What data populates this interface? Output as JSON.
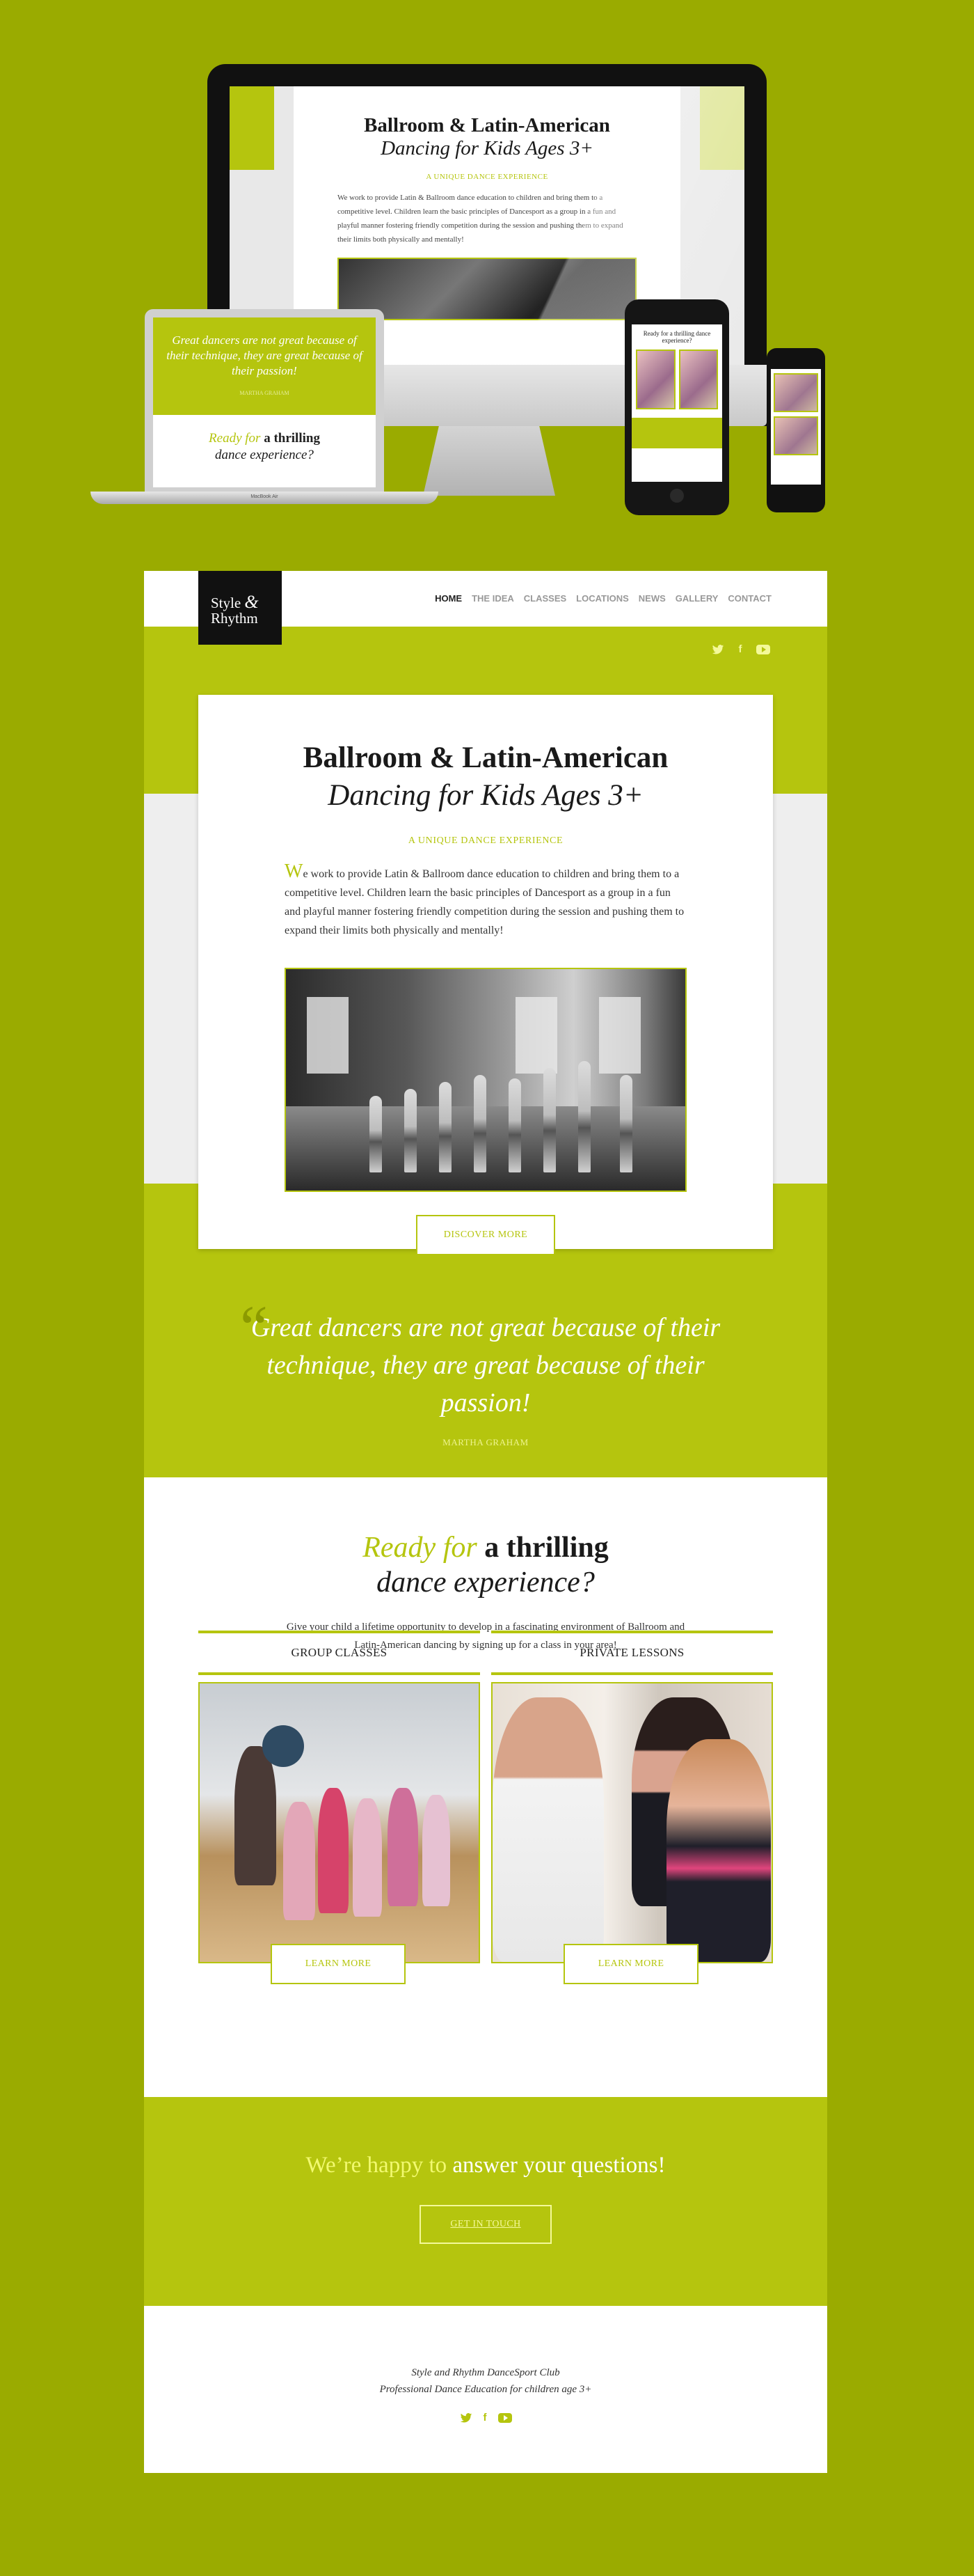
{
  "colors": {
    "page_bg": "#9aab00",
    "accent": "#b5c50e",
    "accent_light": "#f4f99a",
    "dark": "#111111"
  },
  "mockups": {
    "imac_title_1": "Ballroom & Latin-American",
    "imac_title_2": "Dancing for Kids Ages 3+",
    "imac_kicker": "A UNIQUE DANCE EXPERIENCE",
    "imac_para": "We work to provide Latin & Ballroom dance education to children and bring them to a competitive level. Children learn the basic principles of Dancesport as a group in a fun and playful manner fostering friendly competition during the session and pushing them to expand their limits both physically and mentally!",
    "apple_logo": "",
    "laptop_quote": "Great dancers are not great because of their technique, they are great because of their passion!",
    "laptop_author": "MARTHA GRAHAM",
    "laptop_ready_hl": "Ready for",
    "laptop_ready_dk": "a thrilling",
    "laptop_ready_it": "dance experience?",
    "laptop_brand": "MacBook Air",
    "tablet_ready": "Ready for a thrilling dance experience?"
  },
  "header": {
    "logo_line1": "Style",
    "logo_amp": "&",
    "logo_line2": "Rhythm",
    "nav": [
      {
        "label": "HOME",
        "active": true
      },
      {
        "label": "THE IDEA"
      },
      {
        "label": "CLASSES"
      },
      {
        "label": "LOCATIONS"
      },
      {
        "label": "NEWS"
      },
      {
        "label": "GALLERY"
      },
      {
        "label": "CONTACT"
      }
    ],
    "social_icons": [
      "twitter-icon",
      "facebook-icon",
      "youtube-icon"
    ]
  },
  "hero": {
    "title_1": "Ballroom & Latin-American",
    "title_2": "Dancing for Kids Ages 3+",
    "kicker": "A UNIQUE DANCE EXPERIENCE",
    "para_drop": "W",
    "para_rest": "e work to provide Latin & Ballroom dance education to children and bring them to a competitive level. Children learn the basic principles of Dancesport as a group in a fun and playful manner fostering friendly competition during the session and pushing them to expand their limits both physically and mentally!",
    "button": "DISCOVER MORE"
  },
  "quote": {
    "mark": "“",
    "text": "Great dancers are not great because of their technique, they are great because of their passion!",
    "author": "MARTHA GRAHAM"
  },
  "ready": {
    "title_hl": "Ready for",
    "title_dk": "a thrilling",
    "title_it": "dance experience?",
    "desc": "Give your child a lifetime opportunity to develop in a fascinating environment of Ballroom and Latin-American dancing by signing up for a class in your area!",
    "classes": [
      {
        "title": "GROUP CLASSES",
        "button": "LEARN MORE"
      },
      {
        "title": "PRIVATE LESSONS",
        "button": "LEARN MORE"
      }
    ]
  },
  "contact": {
    "title_hl": "We’re happy to",
    "title_rest": "answer your questions!",
    "button": "GET IN TOUCH"
  },
  "footer": {
    "line1": "Style and Rhythm DanceSport Club",
    "line2": "Professional Dance Education for children age 3+"
  }
}
